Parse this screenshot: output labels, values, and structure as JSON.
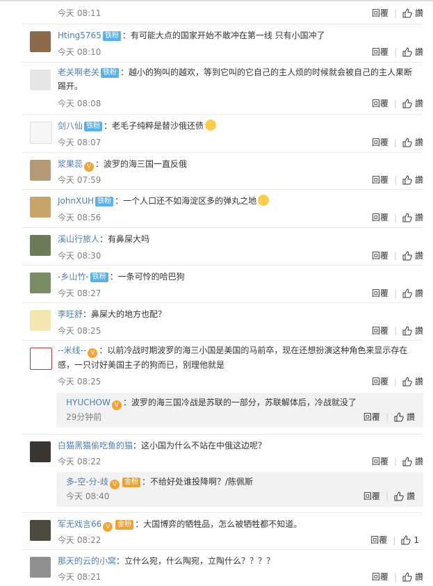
{
  "common": {
    "reply_label": "回覆",
    "like_label": "讚"
  },
  "first_time": "今天 08:11",
  "comments": [
    {
      "user": "Hting5765",
      "badge": "铁粉",
      "text": "：有可能大点的国家开始不敢冲在第一线 只有小国冲了",
      "time": "今天 08:10"
    },
    {
      "user": "老关啊老关",
      "badge": "铁粉",
      "text": "：越小的狗叫的越欢，等到它叫的它自己的主人烦的时候就会被自己的主人果断",
      "text2": "踢开。",
      "time": "今天 08:08"
    },
    {
      "user": "剑八仙",
      "badge": "铁粉",
      "text": "：老毛子纯粹是替沙俄还债",
      "time": "今天 08:07"
    },
    {
      "user": "浆果蕊",
      "text": "：波罗的海三国一直反俄",
      "time": "今天 07:59"
    },
    {
      "user": "JohnXUH",
      "badge": "铁粉",
      "text": "：一个人口还不如海淀区多的弹丸之地",
      "time": "今天 08:56"
    },
    {
      "user": "溪山行旅人",
      "text": "：有鼻屎大吗",
      "time": "今天 08:30"
    },
    {
      "user": "-乡山竹-",
      "badge": "铁粉",
      "text": "：一条可怜的哈巴狗",
      "time": "今天 08:27"
    },
    {
      "user": "李旺舒",
      "text": "：鼻屎大的地方也配？",
      "time": "今天 08:25"
    },
    {
      "user": "--米线--",
      "text": "：以前冷战时期波罗的海三小国是美国的马前卒，现在还想扮演这种角色来显示存在",
      "text2": "感，一只讨好美国主子的狗而已，别理他就是",
      "time": "今天 08:25",
      "reply": {
        "user": "HYUCHOW",
        "text": "：波罗的海三国冷战是苏联的一部分，苏联解体后，冷战就没了",
        "time": "29分钟前"
      }
    },
    {
      "user": "白猫黑猫偷吃鱼的猫",
      "text": "：这小国为什么不站在中俄这边呢？",
      "time": "今天 08:22",
      "reply": {
        "user": "多-空-分-歧",
        "badge": "金粉",
        "text": "：不给好处谁投降啊？/陈佩斯",
        "time": "今天 08:40"
      }
    },
    {
      "user": "军无戏言66",
      "badge": "金粉",
      "text": "：大国博弈的牺牲品，怎么被牺牲都不知道。",
      "time": "今天 08:22",
      "likes": "1"
    },
    {
      "user": "那天的云的小窝",
      "text": "：立什么宛，什么陶宛，立陶什么？？？？",
      "time": "今天 08:21"
    }
  ]
}
